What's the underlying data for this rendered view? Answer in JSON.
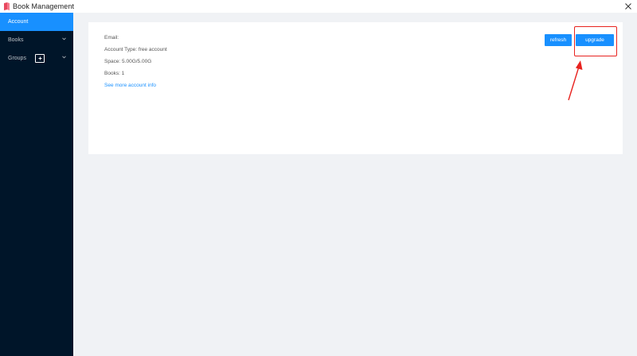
{
  "window": {
    "title": "Book Management",
    "close_icon": "close-icon",
    "logo_icon": "book-logo-icon"
  },
  "sidebar": {
    "items": [
      {
        "label": "Account",
        "active": true,
        "icon": ""
      },
      {
        "label": "Books",
        "active": false,
        "icon": "chevron-down-icon"
      },
      {
        "label": "Groups",
        "active": false,
        "icon": "chevron-down-icon",
        "action_icon": "plus-icon"
      }
    ]
  },
  "account": {
    "email_label": "Email:",
    "account_type": "Account Type: free account",
    "space": "Space: 5.00G/5.00G",
    "books": "Books: 1",
    "more_link": "See more account info"
  },
  "actions": {
    "refresh_label": "refresh",
    "upgrade_label": "upgrade"
  },
  "colors": {
    "sidebar_bg": "#001529",
    "accent": "#1890ff",
    "page_bg": "#f0f2f5",
    "annotation": "#e8231f"
  }
}
